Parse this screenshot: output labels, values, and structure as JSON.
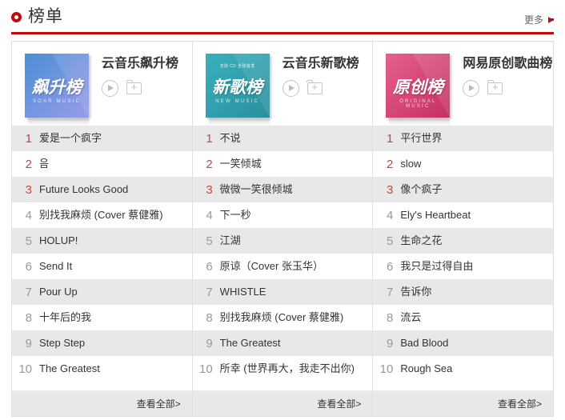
{
  "header": {
    "title": "榜单",
    "dot_icon": "ring-icon",
    "more_label": "更多",
    "more_arrow_icon": "arrow-right-icon",
    "accent_color": "#c20c0c"
  },
  "footer_label": "查看全部>",
  "icons": {
    "play": "play-circle-icon",
    "add": "add-to-playlist-icon"
  },
  "boards": [
    {
      "title": "云音乐飙升榜",
      "cover": {
        "main_text": "飙升榜",
        "sub_text": "SOAR MUSIC",
        "top_text": "",
        "color_start": "#4a8fd6",
        "color_end": "#9a9ce8"
      },
      "songs": [
        {
          "rank": "1",
          "name": "爱是一个疯字"
        },
        {
          "rank": "2",
          "name": "음"
        },
        {
          "rank": "3",
          "name": "Future Looks Good"
        },
        {
          "rank": "4",
          "name": "别找我麻烦 (Cover 蔡健雅)"
        },
        {
          "rank": "5",
          "name": "HOLUP!"
        },
        {
          "rank": "6",
          "name": "Send It"
        },
        {
          "rank": "7",
          "name": "Pour Up"
        },
        {
          "rank": "8",
          "name": "十年后的我"
        },
        {
          "rank": "9",
          "name": "Step Step"
        },
        {
          "rank": "10",
          "name": "The Greatest"
        }
      ]
    },
    {
      "title": "云音乐新歌榜",
      "cover": {
        "main_text": "新歌榜",
        "sub_text": "NEW MUSIC",
        "top_text": "无损 CD 全球首发",
        "color_start": "#39b0bd",
        "color_end": "#2a8f9e"
      },
      "songs": [
        {
          "rank": "1",
          "name": "不说"
        },
        {
          "rank": "2",
          "name": "一笑倾城"
        },
        {
          "rank": "3",
          "name": "微微一笑很倾城"
        },
        {
          "rank": "4",
          "name": "下一秒"
        },
        {
          "rank": "5",
          "name": "江湖"
        },
        {
          "rank": "6",
          "name": "原谅（Cover 张玉华）"
        },
        {
          "rank": "7",
          "name": "WHISTLE"
        },
        {
          "rank": "8",
          "name": "别找我麻烦 (Cover 蔡健雅)"
        },
        {
          "rank": "9",
          "name": "The Greatest"
        },
        {
          "rank": "10",
          "name": "所幸 (世界再大，我走不出你)"
        }
      ]
    },
    {
      "title": "网易原创歌曲榜",
      "cover": {
        "main_text": "原创榜",
        "sub_text": "ORIGINAL MUSIC",
        "top_text": "",
        "color_start": "#e4618e",
        "color_end": "#c62f63"
      },
      "songs": [
        {
          "rank": "1",
          "name": "平行世界"
        },
        {
          "rank": "2",
          "name": "slow"
        },
        {
          "rank": "3",
          "name": "像个疯子"
        },
        {
          "rank": "4",
          "name": "Ely's Heartbeat"
        },
        {
          "rank": "5",
          "name": "生命之花"
        },
        {
          "rank": "6",
          "name": "我只是过得自由"
        },
        {
          "rank": "7",
          "name": "告诉你"
        },
        {
          "rank": "8",
          "name": "流云"
        },
        {
          "rank": "9",
          "name": "Bad Blood"
        },
        {
          "rank": "10",
          "name": "Rough Sea"
        }
      ]
    }
  ]
}
